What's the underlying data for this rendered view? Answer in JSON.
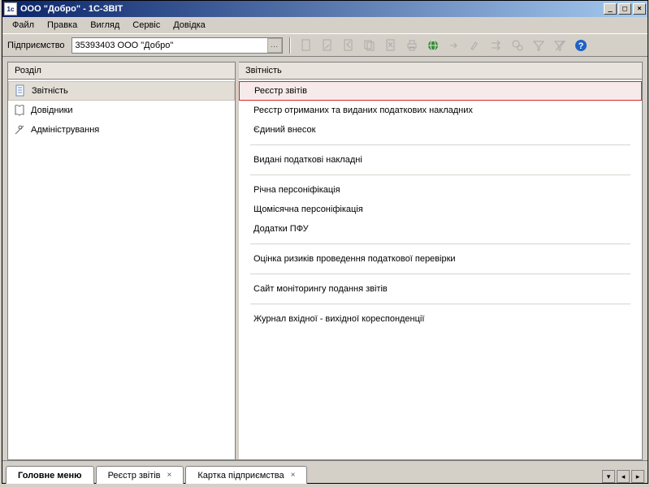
{
  "titlebar": {
    "title": "ООО \"Добро\" - 1С-ЗВІТ"
  },
  "menu": {
    "items": [
      "Файл",
      "Правка",
      "Вигляд",
      "Сервіс",
      "Довідка"
    ]
  },
  "toolbar": {
    "ent_label": "Підприємство",
    "ent_value": "35393403 ООО \"Добро\""
  },
  "left_panel": {
    "header": "Розділ",
    "items": [
      {
        "label": "Звітність",
        "icon": "doc-icon",
        "selected": true
      },
      {
        "label": "Довідники",
        "icon": "book-icon",
        "selected": false
      },
      {
        "label": "Адміністрування",
        "icon": "tools-icon",
        "selected": false
      }
    ]
  },
  "right_panel": {
    "header": "Звітність",
    "groups": [
      [
        {
          "label": "Реєстр звітів",
          "selected": true
        },
        {
          "label": "Реєстр отриманих та виданих податкових накладних",
          "selected": false
        },
        {
          "label": "Єдиний внесок",
          "selected": false
        }
      ],
      [
        {
          "label": "Видані податкові накладні",
          "selected": false
        }
      ],
      [
        {
          "label": "Річна персоніфікація",
          "selected": false
        },
        {
          "label": "Щомісячна персоніфікація",
          "selected": false
        },
        {
          "label": "Додатки ПФУ",
          "selected": false
        }
      ],
      [
        {
          "label": "Оцінка ризиків проведення податкової перевірки",
          "selected": false
        }
      ],
      [
        {
          "label": "Сайт моніторингу подання звітів",
          "selected": false
        }
      ],
      [
        {
          "label": "Журнал вхідної - вихідної кореспонденції",
          "selected": false
        }
      ]
    ]
  },
  "tabs": [
    {
      "label": "Головне меню",
      "closable": false,
      "active": true
    },
    {
      "label": "Реєстр звітів",
      "closable": true,
      "active": false
    },
    {
      "label": "Картка підприємства",
      "closable": true,
      "active": false
    }
  ]
}
